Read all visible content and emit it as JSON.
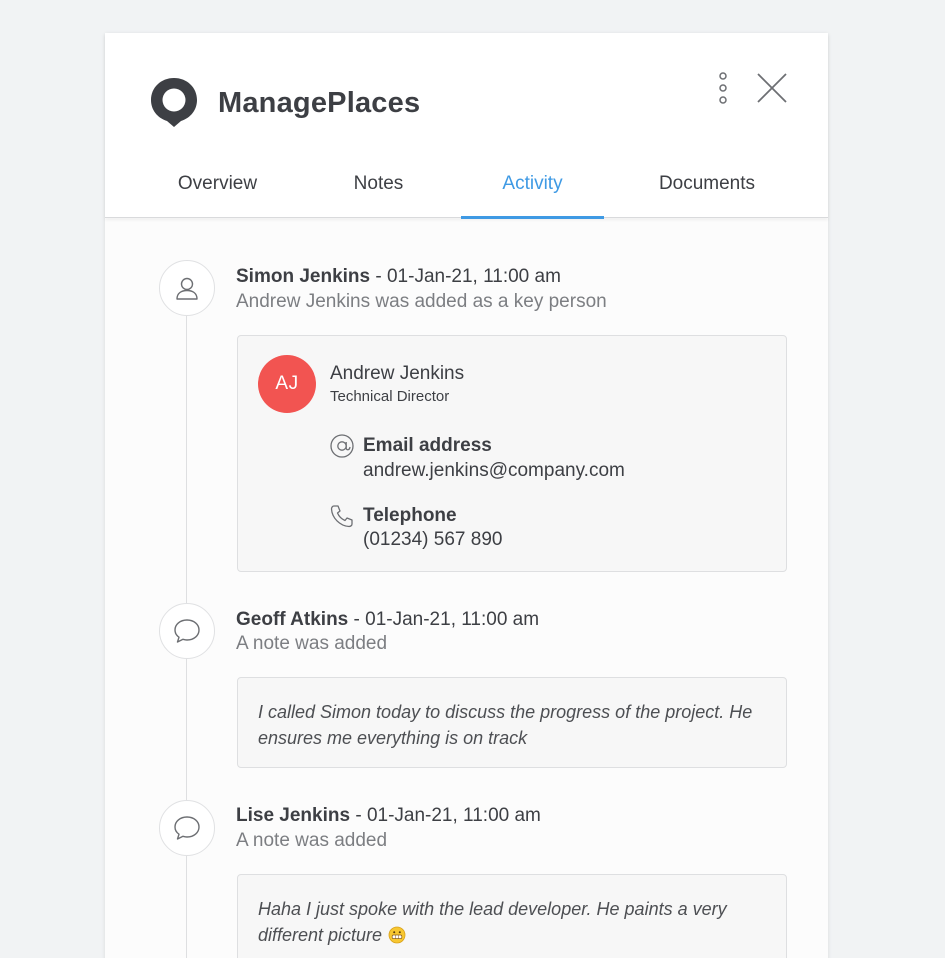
{
  "app": {
    "title": "ManagePlaces",
    "logo_icon": "location-bubble-icon",
    "more_icon": "more-vertical-icon",
    "close_icon": "close-icon"
  },
  "tabs": [
    {
      "label": "Overview",
      "active": false
    },
    {
      "label": "Notes",
      "active": false
    },
    {
      "label": "Activity",
      "active": true
    },
    {
      "label": "Documents",
      "active": false
    }
  ],
  "colors": {
    "accent": "#3f9ae4",
    "avatar_bg": "#f25451",
    "text": "#3d3f44",
    "muted": "#7c7e82"
  },
  "activity": [
    {
      "icon": "user-icon",
      "author": "Simon Jenkins",
      "timestamp": " - 01-Jan-21, 11:00 am",
      "description": "Andrew Jenkins was added as a key person",
      "person": {
        "initials": "AJ",
        "name": "Andrew Jenkins",
        "role": "Technical Director",
        "email_icon": "at-icon",
        "email_label": "Email address",
        "email": "andrew.jenkins@company.com",
        "phone_icon": "phone-icon",
        "phone_label": "Telephone",
        "phone": "(01234) 567 890"
      }
    },
    {
      "icon": "speech-bubble-icon",
      "author": "Geoff Atkins",
      "timestamp": " - 01-Jan-21, 11:00 am",
      "description": "A note was added",
      "note": "I called Simon today to discuss the progress of the project. He ensures me everything is on track"
    },
    {
      "icon": "speech-bubble-icon",
      "author": "Lise Jenkins",
      "timestamp": " - 01-Jan-21, 11:00 am",
      "description": "A note was added",
      "note": "Haha I just spoke with the lead developer. He paints a very different picture",
      "emoji": "grimace-emoji-icon"
    }
  ]
}
